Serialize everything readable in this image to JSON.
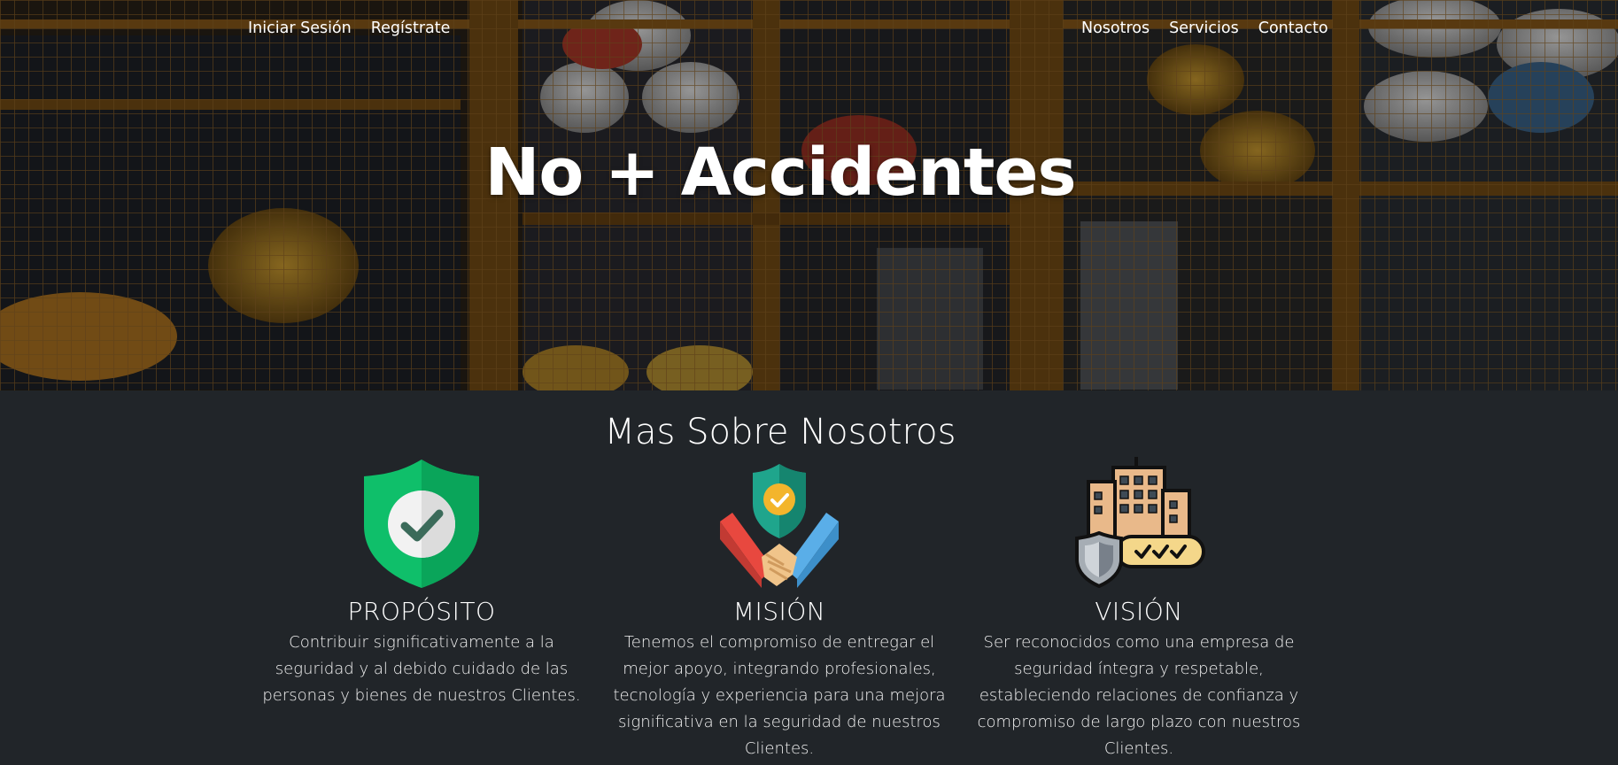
{
  "nav": {
    "login": "Iniciar Sesión",
    "register": "Regístrate",
    "about": "Nosotros",
    "services": "Servicios",
    "contact": "Contacto"
  },
  "hero": {
    "title": "No + Accidentes"
  },
  "about": {
    "title": "Mas Sobre Nosotros",
    "cards": [
      {
        "title": "PROPÓSITO",
        "text": "Contribuir significativamente a la seguridad y al debido cuidado de las personas y bienes de nuestros Clientes.",
        "icon": "shield-check-icon"
      },
      {
        "title": "MISIÓN",
        "text": "Tenemos el compromiso de entregar el mejor apoyo, integrando profesionales, tecnología y experiencia para una mejora significativa en la seguridad de nuestros Clientes.",
        "icon": "handshake-shield-icon"
      },
      {
        "title": "VISIÓN",
        "text": "Ser reconocidos como una empresa de seguridad íntegra y respetable, estableciendo relaciones de confianza y compromiso de largo plazo con nuestros Clientes.",
        "icon": "secure-building-icon"
      }
    ]
  },
  "colors": {
    "background": "#212529",
    "text": "#ffffff",
    "shield_green": "#0fbf6a",
    "hero_dark": "#2a2118"
  }
}
